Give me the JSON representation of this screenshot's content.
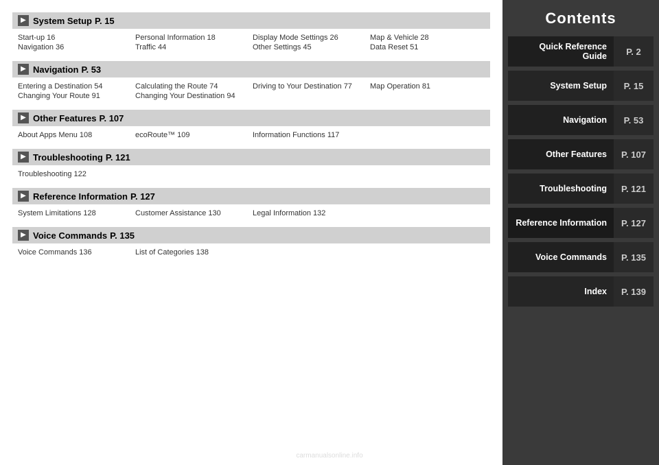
{
  "main": {
    "sections": [
      {
        "id": "system-setup",
        "title": "System Setup",
        "page": "P. 15",
        "items": [
          "Start-up 16",
          "Personal Information 18",
          "Display Mode Settings 26",
          "Map & Vehicle 28",
          "Navigation 36",
          "Traffic 44",
          "Other Settings 45",
          "Data Reset 51"
        ]
      },
      {
        "id": "navigation",
        "title": "Navigation",
        "page": "P. 53",
        "items": [
          "Entering a Destination 54",
          "Calculating the Route 74",
          "Driving to Your Destination 77",
          "Map Operation 81",
          "Changing Your Route 91",
          "Changing Your Destination 94",
          "",
          ""
        ]
      },
      {
        "id": "other-features",
        "title": "Other Features",
        "page": "P. 107",
        "items": [
          "About Apps Menu 108",
          "ecoRoute™ 109",
          "Information Functions 117",
          ""
        ]
      },
      {
        "id": "troubleshooting",
        "title": "Troubleshooting",
        "page": "P. 121",
        "items": [
          "Troubleshooting 122",
          "",
          "",
          ""
        ]
      },
      {
        "id": "reference-information",
        "title": "Reference Information",
        "page": "P. 127",
        "items": [
          "System Limitations 128",
          "Customer Assistance 130",
          "Legal Information 132",
          ""
        ]
      },
      {
        "id": "voice-commands",
        "title": "Voice Commands",
        "page": "P. 135",
        "items": [
          "Voice Commands 136",
          "List of Categories 138",
          "",
          ""
        ]
      }
    ]
  },
  "sidebar": {
    "title": "Contents",
    "items": [
      {
        "id": "quick-reference",
        "label": "Quick Reference Guide",
        "page": "P. 2"
      },
      {
        "id": "system-setup",
        "label": "System Setup",
        "page": "P. 15"
      },
      {
        "id": "navigation",
        "label": "Navigation",
        "page": "P. 53"
      },
      {
        "id": "other-features",
        "label": "Other Features",
        "page": "P. 107"
      },
      {
        "id": "troubleshooting",
        "label": "Troubleshooting",
        "page": "P. 121"
      },
      {
        "id": "reference-information",
        "label": "Reference Information",
        "page": "P. 127"
      },
      {
        "id": "voice-commands",
        "label": "Voice Commands",
        "page": "P. 135"
      },
      {
        "id": "index",
        "label": "Index",
        "page": "P. 139"
      }
    ]
  },
  "watermark": "carmanualsonline.info"
}
